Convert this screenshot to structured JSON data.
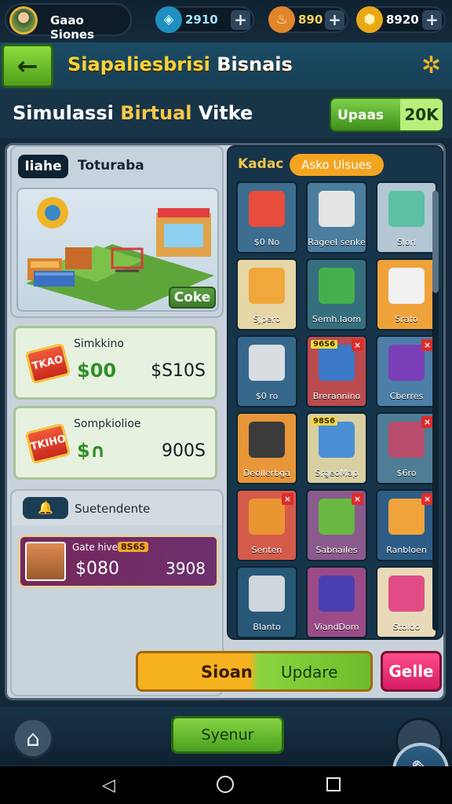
{
  "topbar": {
    "profile_name": "Gaao Siones",
    "gems": "2910",
    "energy": "890",
    "coins": "8920",
    "gem_icon": "gem-icon",
    "energy_icon": "flame-icon",
    "coin_icon": "coin-icon",
    "plus": "+"
  },
  "header": {
    "title_yellow": "Siapaliesbrisi",
    "title_white": "Bisnais",
    "back_icon": "back-arrow-icon",
    "settings_icon": "gear-icon"
  },
  "subheader": {
    "title_white": "Simulassi",
    "title_yellow": "Birtual",
    "title_end": "Vitke",
    "upgrade_label": "Upaas",
    "upgrade_value": "20K"
  },
  "info_card": {
    "tag": "Iiahe",
    "label": "Toturaba",
    "button": "Coke"
  },
  "stats": [
    {
      "badge": "TKAO",
      "label": "Simkkino",
      "value": "$00",
      "right": "$S10S"
    },
    {
      "badge": "TKIHO",
      "label": "Sompkiolioe",
      "value": "$∩",
      "right": "900S"
    }
  ],
  "news": {
    "title": "Suetendente",
    "promo_label": "Gate hive",
    "promo_tag": "8S6S",
    "promo_value": "$080",
    "promo_right": "3908"
  },
  "shop": {
    "label": "Kadac",
    "tab": "Asko Uisues",
    "items": [
      {
        "label": "$0 No",
        "color": "#3d6d8f",
        "art": "#e84c3c"
      },
      {
        "label": "Rageel senke",
        "color": "#4a7d9e",
        "art": "#e4e4e4"
      },
      {
        "label": "Slorl",
        "color": "#b2c6d3",
        "art": "#5cc0a4"
      },
      {
        "label": "Sjpero",
        "color": "#e7d6a6",
        "art": "#f0a83a"
      },
      {
        "label": "Semh.laom",
        "color": "#356f7e",
        "art": "#45b04b"
      },
      {
        "label": "Srato",
        "color": "#f0a23a",
        "art": "#f1f1f1"
      },
      {
        "label": "$0 ro",
        "color": "#35678a",
        "art": "#d8dde2"
      },
      {
        "label": "Brerannino",
        "color": "#b94b4f",
        "art": "#3a78c8",
        "tag": "96S6",
        "close": true
      },
      {
        "label": "Cberres",
        "color": "#4d7ea8",
        "art": "#7a3fb6",
        "close": true
      },
      {
        "label": "Deollerbga",
        "color": "#e7963a",
        "art": "#3b3b3b"
      },
      {
        "label": "SrgeoMap",
        "color": "#d8cfa3",
        "art": "#4a8fd6",
        "tag": "98S6"
      },
      {
        "label": "$6ro",
        "color": "#4f7d96",
        "art": "#b94d6d",
        "close": true
      },
      {
        "label": "Senten",
        "color": "#d45b4a",
        "art": "#e99532",
        "close": true
      },
      {
        "label": "Sabnailes",
        "color": "#8a5a8c",
        "art": "#68b842",
        "close": true
      },
      {
        "label": "Ranbloen",
        "color": "#2d5d86",
        "art": "#f0a33a",
        "close": true
      },
      {
        "label": "Blanto",
        "color": "#275876",
        "art": "#cfd6dc"
      },
      {
        "label": "ViandDom",
        "color": "#9b4c88",
        "art": "#4a3fb2"
      },
      {
        "label": "Stoldo",
        "color": "#e8d9b8",
        "art": "#e14c86"
      }
    ]
  },
  "actions": {
    "update_left": "Sioan",
    "update_right": "Updare",
    "cancel": "Gelle"
  },
  "bottom": {
    "nav_label": "Syenur",
    "home_icon": "home-icon"
  }
}
